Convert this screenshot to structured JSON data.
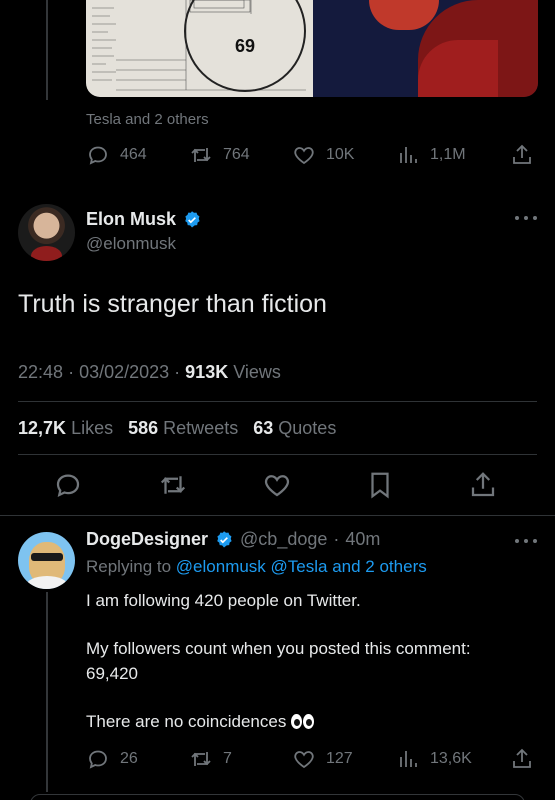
{
  "prev_tweet": {
    "media": {
      "number_label": "69"
    },
    "context": "Tesla and 2 others",
    "actions": {
      "replies": "464",
      "retweets": "764",
      "likes": "10K",
      "views": "1,1M"
    }
  },
  "main_tweet": {
    "name": "Elon Musk",
    "handle": "@elonmusk",
    "text": "Truth is stranger than fiction",
    "time": "22:48",
    "date": "03/02/2023",
    "views_count": "913K",
    "views_label": "Views",
    "likes_count": "12,7K",
    "likes_label": "Likes",
    "retweets_count": "586",
    "retweets_label": "Retweets",
    "quotes_count": "63",
    "quotes_label": "Quotes"
  },
  "reply": {
    "name": "DogeDesigner",
    "handle": "@cb_doge",
    "age": "40m",
    "replying_prefix": "Replying to",
    "replying_mention": "@elonmusk",
    "replying_others": "@Tesla and 2 others",
    "line1": "I am following 420 people on Twitter.",
    "line2": "My followers count when you posted this comment:",
    "line3": "69,420",
    "line4": "There are no coincidences",
    "actions": {
      "replies": "26",
      "retweets": "7",
      "likes": "127",
      "views": "13,6K"
    }
  },
  "colors": {
    "accent": "#1d9bf0",
    "muted": "#71767b",
    "text": "#e7e9ea",
    "background": "#000000"
  },
  "icons": [
    "reply-icon",
    "retweet-icon",
    "like-icon",
    "views-icon",
    "share-icon",
    "bookmark-icon",
    "verified-icon",
    "more-icon",
    "eyes-emoji"
  ]
}
